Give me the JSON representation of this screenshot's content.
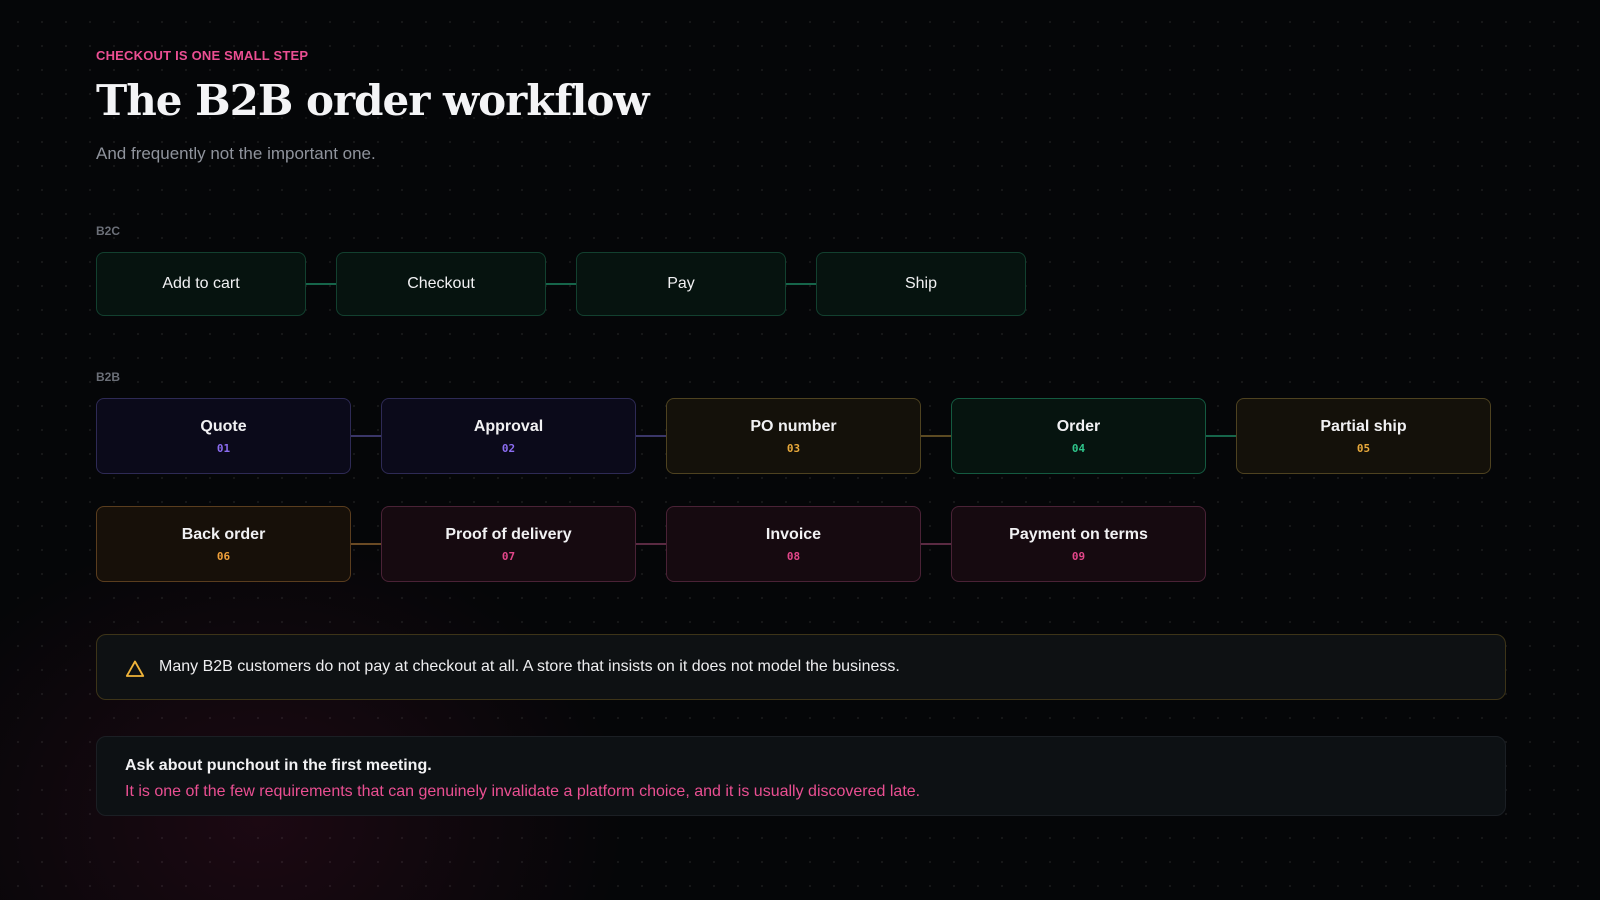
{
  "eyebrow": "CHECKOUT IS ONE SMALL STEP",
  "title": "The B2B order workflow",
  "subtitle": "And frequently not the important one.",
  "b2c": {
    "label": "B2C",
    "steps": [
      "Add to cart",
      "Checkout",
      "Pay",
      "Ship"
    ]
  },
  "b2b": {
    "label": "B2B",
    "row1": [
      {
        "label": "Quote",
        "num": "01"
      },
      {
        "label": "Approval",
        "num": "02"
      },
      {
        "label": "PO number",
        "num": "03"
      },
      {
        "label": "Order",
        "num": "04"
      },
      {
        "label": "Partial ship",
        "num": "05"
      }
    ],
    "row2": [
      {
        "label": "Back order",
        "num": "06"
      },
      {
        "label": "Proof of delivery",
        "num": "07"
      },
      {
        "label": "Invoice",
        "num": "08"
      },
      {
        "label": "Payment on terms",
        "num": "09"
      }
    ]
  },
  "warning": {
    "icon": "warning-triangle-icon",
    "text": "Many B2B customers do not pay at checkout at all. A store that insists on it does not model the business."
  },
  "tip": {
    "heading": "Ask about punchout in the first meeting.",
    "body": "It is one of the few requirements that can genuinely invalidate a platform choice, and it is usually discovered late."
  },
  "colors": {
    "accent_pink": "#ec4f93",
    "b2c_connector": "#16654a",
    "purple": "#8b6cf0",
    "gold": "#e8a93b",
    "green": "#2ec48a",
    "amber": "#f0a03a",
    "pink": "#e3468a"
  }
}
